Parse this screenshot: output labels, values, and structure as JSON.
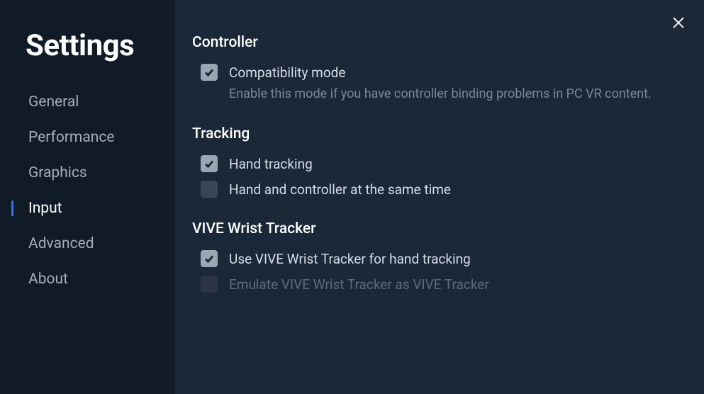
{
  "sidebar": {
    "title": "Settings",
    "items": [
      {
        "label": "General"
      },
      {
        "label": "Performance"
      },
      {
        "label": "Graphics"
      },
      {
        "label": "Input"
      },
      {
        "label": "Advanced"
      },
      {
        "label": "About"
      }
    ],
    "active_index": 3
  },
  "sections": {
    "controller": {
      "title": "Controller",
      "compat_label": "Compatibility mode",
      "compat_desc": "Enable this mode if you have controller binding problems in PC VR content."
    },
    "tracking": {
      "title": "Tracking",
      "hand_label": "Hand tracking",
      "simul_label": "Hand and controller at the same time"
    },
    "wrist": {
      "title": "VIVE Wrist Tracker",
      "use_label": "Use VIVE Wrist Tracker for hand tracking",
      "emulate_label": "Emulate VIVE Wrist Tracker as VIVE Tracker"
    }
  }
}
